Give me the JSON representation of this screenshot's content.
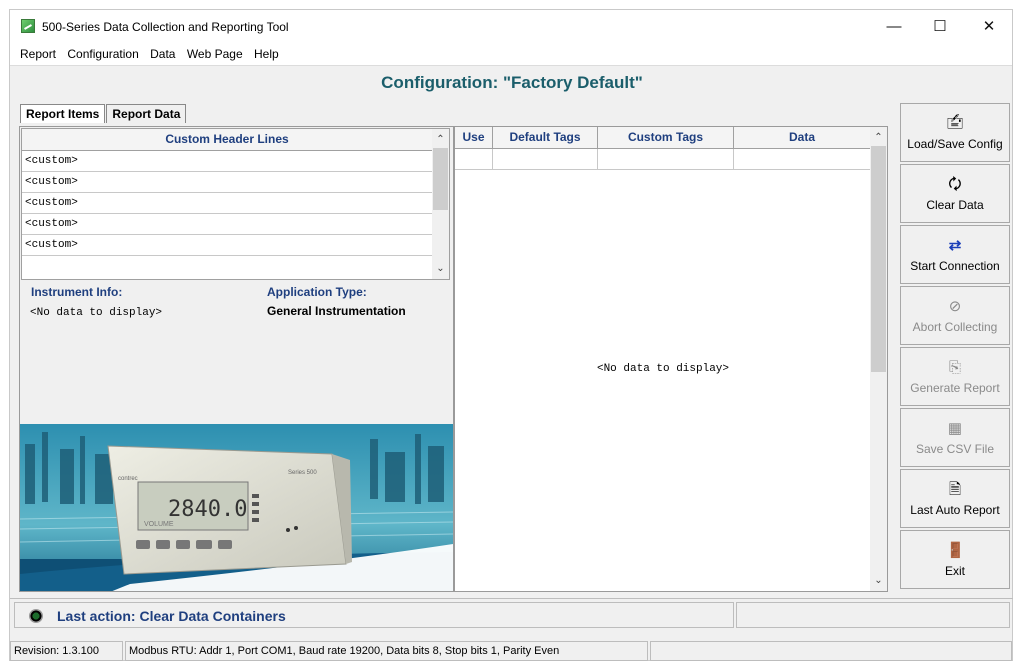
{
  "window": {
    "title": "500-Series Data Collection and Reporting Tool",
    "controls": {
      "minimize": "—",
      "maximize": "☐",
      "close": "✕"
    }
  },
  "menu": [
    "Report",
    "Configuration",
    "Data",
    "Web Page",
    "Help"
  ],
  "config_title": "Configuration: \"Factory Default\"",
  "tabs": {
    "report_items": "Report Items",
    "report_data": "Report Data",
    "active": "Report Items"
  },
  "header_lines": {
    "column": "Custom Header Lines",
    "rows": [
      "<custom>",
      "<custom>",
      "<custom>",
      "<custom>",
      "<custom>",
      ""
    ]
  },
  "instrument_info": {
    "label": "Instrument Info:",
    "value": "<No data to display>"
  },
  "application_type": {
    "label": "Application Type:",
    "value": "General Instrumentation"
  },
  "device_image": {
    "brand": "contrec",
    "model": "Series 500",
    "reading": "2840.0",
    "unit": "VOLUME"
  },
  "data_table": {
    "columns": [
      "Use",
      "Default Tags",
      "Custom Tags",
      "Data"
    ],
    "empty_text": "<No data to display>"
  },
  "sidebar": [
    {
      "label": "Load/Save Config",
      "icon": "load-save-config-icon",
      "glyph": "🖆",
      "enabled": true
    },
    {
      "label": "Clear Data",
      "icon": "clear-data-icon",
      "glyph": "🗘",
      "enabled": true
    },
    {
      "label": "Start Connection",
      "icon": "start-connection-icon",
      "glyph": "⇄",
      "enabled": true
    },
    {
      "label": "Abort Collecting",
      "icon": "abort-collecting-icon",
      "glyph": "⊘",
      "enabled": false
    },
    {
      "label": "Generate Report",
      "icon": "generate-report-icon",
      "glyph": "⎘",
      "enabled": false
    },
    {
      "label": "Save CSV File",
      "icon": "save-csv-file-icon",
      "glyph": "▦",
      "enabled": false
    },
    {
      "label": "Last Auto Report",
      "icon": "last-auto-report-icon",
      "glyph": "🗎",
      "enabled": true
    },
    {
      "label": "Exit",
      "icon": "exit-icon",
      "glyph": "🚪",
      "enabled": true
    }
  ],
  "last_action": "Last action: Clear Data Containers",
  "status": {
    "revision": "Revision:  1.3.100",
    "connection": "Modbus RTU: Addr 1, Port COM1, Baud rate 19200, Data bits 8, Stop bits 1, Parity Even"
  },
  "colors": {
    "heading": "#1f3f7f",
    "title": "#1b5e6b",
    "led": "#1b6b2b"
  }
}
